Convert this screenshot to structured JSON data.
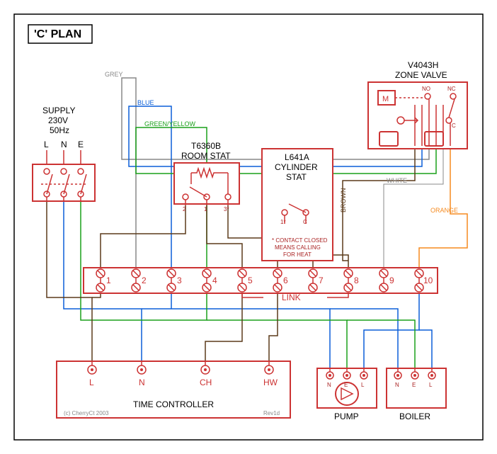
{
  "diagram": {
    "title": "'C' PLAN",
    "supply": {
      "heading": "SUPPLY",
      "voltage": "230V",
      "freq": "50Hz",
      "terms": [
        "L",
        "N",
        "E"
      ]
    },
    "roomstat": {
      "heading1": "T6360B",
      "heading2": "ROOM STAT",
      "terms": [
        "2",
        "1",
        "3*"
      ]
    },
    "cylinder": {
      "heading1": "L641A",
      "heading2": "CYLINDER",
      "heading3": "STAT",
      "terms": [
        "1*",
        "C"
      ],
      "note1": "* CONTACT CLOSED",
      "note2": "MEANS CALLING",
      "note3": "FOR HEAT"
    },
    "valve": {
      "heading1": "V4043H",
      "heading2": "ZONE VALVE",
      "m": "M",
      "no": "NO",
      "nc": "NC",
      "c": "C"
    },
    "junction": {
      "terms": [
        "1",
        "2",
        "3",
        "4",
        "5",
        "6",
        "7",
        "8",
        "9",
        "10"
      ],
      "link": "LINK"
    },
    "time": {
      "heading": "TIME CONTROLLER",
      "terms": [
        "L",
        "N",
        "CH",
        "HW"
      ],
      "copyright": "(c) CherryCt 2003",
      "revision": "Rev1d"
    },
    "pump": {
      "heading": "PUMP",
      "terms": [
        "N",
        "E",
        "L"
      ]
    },
    "boiler": {
      "heading": "BOILER",
      "terms": [
        "N",
        "E",
        "L"
      ]
    },
    "wirelabels": {
      "grey": "GREY",
      "blue": "BLUE",
      "green": "GREEN/YELLOW",
      "brown": "BROWN",
      "white": "WHITE",
      "orange": "ORANGE"
    }
  }
}
